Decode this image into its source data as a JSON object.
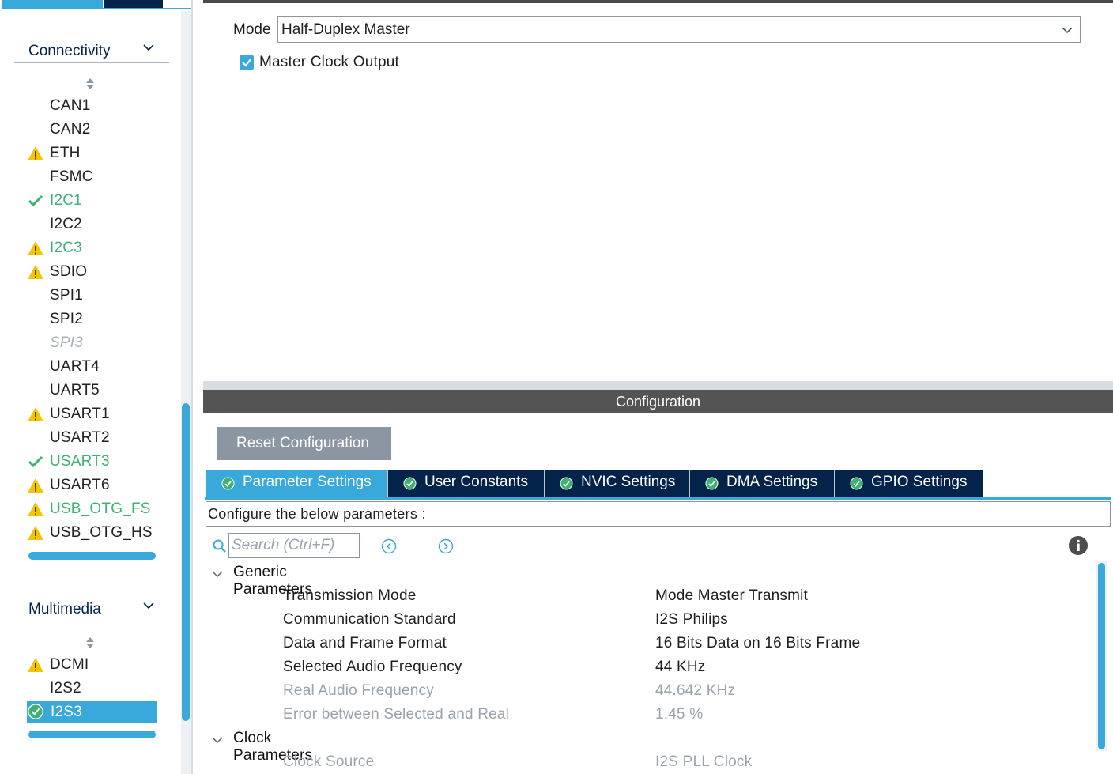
{
  "colors": {
    "accent": "#39a9dc",
    "navy": "#03234b",
    "ok_green": "#3cb371",
    "warning_yellow": "#f5c400",
    "header_gray": "#545454",
    "button_gray": "#8c96a2"
  },
  "sidebar": {
    "connectivity": {
      "title": "Connectivity",
      "items": [
        {
          "label": "CAN1",
          "status": "none"
        },
        {
          "label": "CAN2",
          "status": "none"
        },
        {
          "label": "ETH",
          "status": "warning"
        },
        {
          "label": "FSMC",
          "status": "none"
        },
        {
          "label": "I2C1",
          "status": "ok"
        },
        {
          "label": "I2C2",
          "status": "none"
        },
        {
          "label": "I2C3",
          "status": "warning-green"
        },
        {
          "label": "SDIO",
          "status": "warning"
        },
        {
          "label": "SPI1",
          "status": "none"
        },
        {
          "label": "SPI2",
          "status": "none"
        },
        {
          "label": "SPI3",
          "status": "disabled"
        },
        {
          "label": "UART4",
          "status": "none"
        },
        {
          "label": "UART5",
          "status": "none"
        },
        {
          "label": "USART1",
          "status": "warning"
        },
        {
          "label": "USART2",
          "status": "none"
        },
        {
          "label": "USART3",
          "status": "ok"
        },
        {
          "label": "USART6",
          "status": "warning"
        },
        {
          "label": "USB_OTG_FS",
          "status": "warning-green"
        },
        {
          "label": "USB_OTG_HS",
          "status": "warning"
        }
      ]
    },
    "multimedia": {
      "title": "Multimedia",
      "items": [
        {
          "label": "DCMI",
          "status": "warning"
        },
        {
          "label": "I2S2",
          "status": "none"
        },
        {
          "label": "I2S3",
          "status": "selected-ok"
        }
      ]
    }
  },
  "mode": {
    "label": "Mode",
    "value": "Half-Duplex Master",
    "master_clock_label": "Master Clock Output",
    "master_clock_checked": true
  },
  "configuration": {
    "header": "Configuration",
    "reset_label": "Reset Configuration",
    "tabs": [
      {
        "label": "Parameter Settings",
        "active": true
      },
      {
        "label": "User Constants",
        "active": false
      },
      {
        "label": "NVIC Settings",
        "active": false
      },
      {
        "label": "DMA Settings",
        "active": false
      },
      {
        "label": "GPIO Settings",
        "active": false
      }
    ],
    "configure_text": "Configure the below parameters :",
    "search_placeholder": "Search (Ctrl+F)",
    "groups": [
      {
        "label": "Generic Parameters",
        "params": [
          {
            "name": "Transmission Mode",
            "value": "Mode Master Transmit",
            "readonly": false
          },
          {
            "name": "Communication Standard",
            "value": "I2S Philips",
            "readonly": false
          },
          {
            "name": "Data and Frame Format",
            "value": "16 Bits Data on 16 Bits Frame",
            "readonly": false
          },
          {
            "name": "Selected Audio Frequency",
            "value": "44 KHz",
            "readonly": false
          },
          {
            "name": "Real Audio Frequency",
            "value": "44.642 KHz",
            "readonly": true
          },
          {
            "name": "Error between Selected and Real",
            "value": "1.45 %",
            "readonly": true
          }
        ]
      },
      {
        "label": "Clock Parameters",
        "params": [
          {
            "name": "Clock Source",
            "value": "I2S PLL Clock",
            "readonly": true
          }
        ]
      }
    ]
  }
}
